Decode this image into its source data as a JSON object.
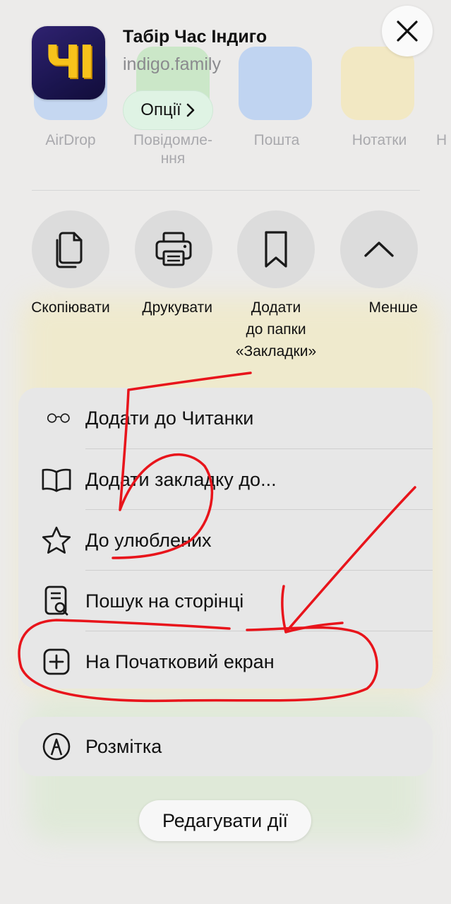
{
  "header": {
    "app_icon_text": "ЧІ",
    "title": "Табір Час Індиго",
    "url": "indigo.family",
    "options_label": "Опції"
  },
  "share_targets": [
    {
      "label": "AirDrop"
    },
    {
      "label": "Повідомле-\nння"
    },
    {
      "label": "Пошта"
    },
    {
      "label": "Нотатки"
    },
    {
      "label": "Н"
    }
  ],
  "actions": [
    {
      "label": "Скопіювати",
      "icon": "copy-icon"
    },
    {
      "label": "Друкувати",
      "icon": "printer-icon"
    },
    {
      "label": "Додати\nдо папки\n«Закладки»",
      "icon": "bookmark-icon"
    },
    {
      "label": "Менше",
      "icon": "chevron-up-icon"
    }
  ],
  "menu": [
    {
      "label": "Додати до Читанки",
      "icon": "glasses-icon"
    },
    {
      "label": "Додати закладку до...",
      "icon": "book-icon"
    },
    {
      "label": "До улюблених",
      "icon": "star-icon"
    },
    {
      "label": "Пошук на сторінці",
      "icon": "find-page-icon"
    },
    {
      "label": "На Початковий екран",
      "icon": "add-square-icon"
    }
  ],
  "markup": {
    "label": "Розмітка",
    "icon": "markup-pen-icon"
  },
  "edit_actions_label": "Редагувати дії",
  "annotation": {
    "number": "5",
    "color": "#e8141b"
  },
  "colors": {
    "options_bg": "#dff3e4",
    "sheet_bg": "#f2f1f0",
    "card_bg": "#e7e7e7"
  }
}
